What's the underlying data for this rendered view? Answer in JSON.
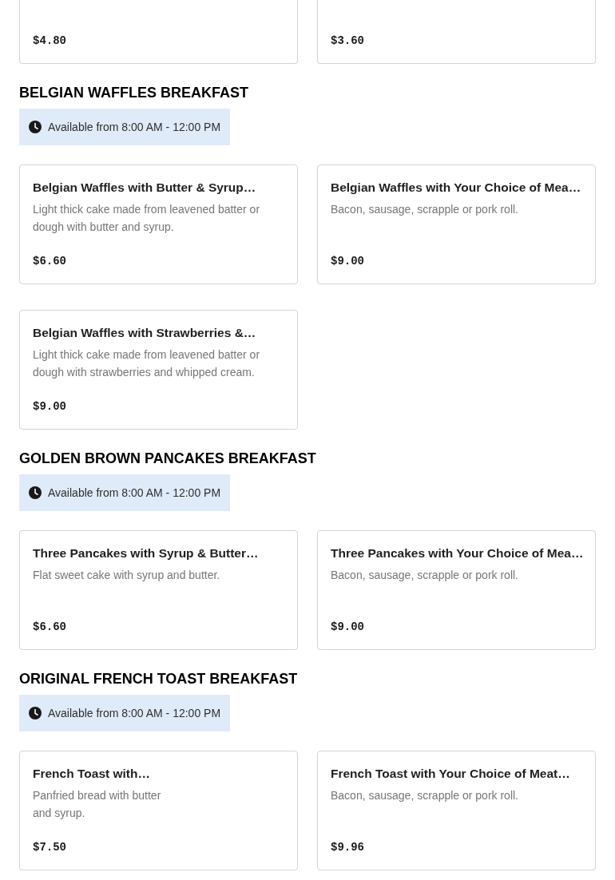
{
  "partial_items": [
    {
      "price": "$4.80"
    },
    {
      "price": "$3.60"
    }
  ],
  "sections": [
    {
      "title": "BELGIAN WAFFLES BREAKFAST",
      "availability": "Available from 8:00 AM - 12:00 PM",
      "items": [
        {
          "name": "Belgian Waffles with Butter & Syrup…",
          "description": "Light thick cake made from leavened batter or dough with butter and syrup.",
          "price": "$6.60"
        },
        {
          "name": "Belgian Waffles with Your Choice of Mea…",
          "description": "Bacon, sausage, scrapple or pork roll.",
          "price": "$9.00"
        },
        {
          "name": "Belgian Waffles with Strawberries &…",
          "description": "Light thick cake made from leavened batter or dough with strawberries and whipped cream.",
          "price": "$9.00"
        }
      ]
    },
    {
      "title": "GOLDEN BROWN PANCAKES BREAKFAST",
      "availability": "Available from 8:00 AM - 12:00 PM",
      "items": [
        {
          "name": "Three Pancakes with Syrup & Butter…",
          "description": "Flat sweet cake with syrup and butter.",
          "price": "$6.60"
        },
        {
          "name": "Three Pancakes with Your Choice of Mea…",
          "description": "Bacon, sausage, scrapple or pork roll.",
          "price": "$9.00"
        }
      ]
    },
    {
      "title": "ORIGINAL FRENCH TOAST BREAKFAST",
      "availability": "Available from 8:00 AM - 12:00 PM",
      "items": [
        {
          "name": "French Toast with…",
          "description": "Panfried bread with butter\nand syrup.",
          "price": "$7.50"
        },
        {
          "name": "French Toast with Your Choice of Meat…",
          "description": "Bacon, sausage, scrapple or pork roll.",
          "price": "$9.96"
        }
      ]
    }
  ]
}
